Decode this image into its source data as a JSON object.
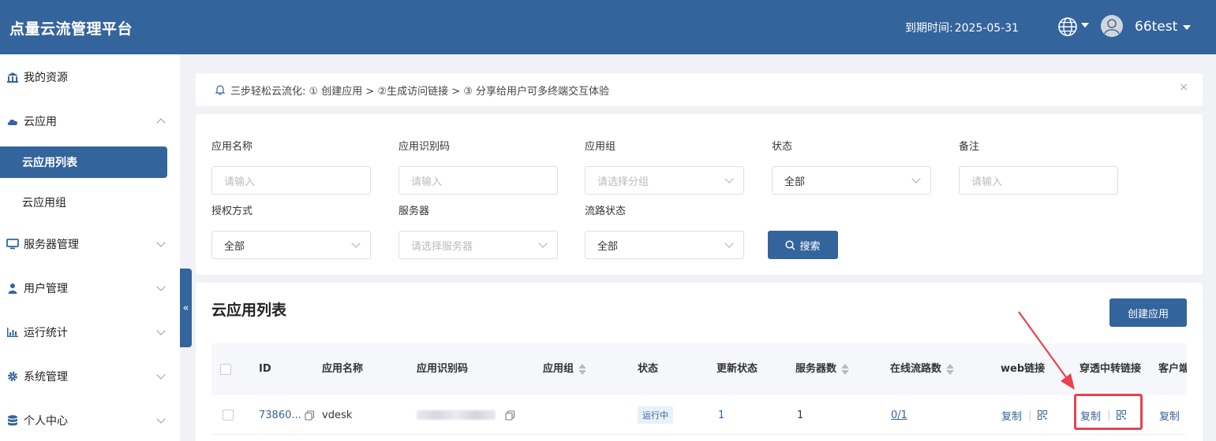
{
  "header": {
    "brand": "点量云流管理平台",
    "expiry_label": "到期时间:",
    "expiry_value": "2025-05-31",
    "username": "66test"
  },
  "sidebar": {
    "items": [
      {
        "label": "我的资源"
      },
      {
        "label": "云应用"
      },
      {
        "label": "云应用列表"
      },
      {
        "label": "云应用组"
      },
      {
        "label": "服务器管理"
      },
      {
        "label": "用户管理"
      },
      {
        "label": "运行统计"
      },
      {
        "label": "系统管理"
      },
      {
        "label": "个人中心"
      }
    ],
    "collapse_glyph": "«"
  },
  "notice": {
    "text": "三步轻松云流化: ① 创建应用 > ②生成访问链接 > ③ 分享给用户可多终端交互体验",
    "close_glyph": "×"
  },
  "filters": {
    "app_name": {
      "label": "应用名称",
      "placeholder": "请输入"
    },
    "app_code": {
      "label": "应用识别码",
      "placeholder": "请输入"
    },
    "app_group": {
      "label": "应用组",
      "placeholder": "请选择分组"
    },
    "status": {
      "label": "状态",
      "value": "全部"
    },
    "remark": {
      "label": "备注",
      "placeholder": "请输入"
    },
    "auth_mode": {
      "label": "授权方式",
      "value": "全部"
    },
    "server": {
      "label": "服务器",
      "placeholder": "请选择服务器"
    },
    "stream_status": {
      "label": "流路状态",
      "value": "全部"
    },
    "search_label": "搜索"
  },
  "list": {
    "title": "云应用列表",
    "create_label": "创建应用",
    "columns": {
      "id": "ID",
      "name": "应用名称",
      "code": "应用识别码",
      "group": "应用组",
      "status": "状态",
      "update_status": "更新状态",
      "servers": "服务器数",
      "online_streams": "在线流路数",
      "web_link": "web链接",
      "relay_link": "穿透中转链接",
      "client": "客户端"
    },
    "rows": [
      {
        "id": "73860...",
        "name": "vdesk",
        "status": "运行中",
        "update_status": "1",
        "servers": "1",
        "online_streams": "0/1",
        "web_copy": "复制",
        "relay_copy": "复制",
        "client_copy": "复制"
      }
    ]
  },
  "colors": {
    "primary": "#34649c",
    "highlight": "#e8424f"
  }
}
